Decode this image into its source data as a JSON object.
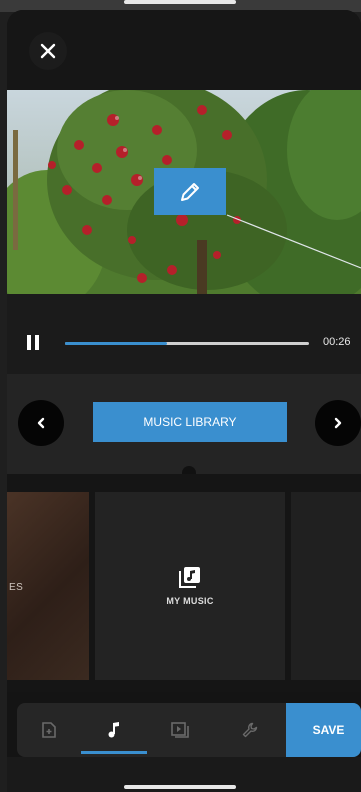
{
  "player": {
    "time": "00:26",
    "progress_fraction": 0.42
  },
  "picker": {
    "library_label": "MUSIC LIBRARY"
  },
  "cards": {
    "left_partial_text": "ES",
    "center_label": "MY MUSIC"
  },
  "toolbar": {
    "save_label": "SAVE",
    "active_tool": "music"
  },
  "colors": {
    "accent": "#3a8fcf",
    "background": "#141414"
  },
  "icons": {
    "close": "close-icon",
    "edit": "pencil-icon",
    "pause": "pause-icon",
    "prev": "chevron-left-icon",
    "next": "chevron-right-icon",
    "my_music": "music-library-icon",
    "add_clip": "add-clip-icon",
    "music": "music-note-icon",
    "format": "format-icon",
    "settings": "wrench-icon"
  }
}
